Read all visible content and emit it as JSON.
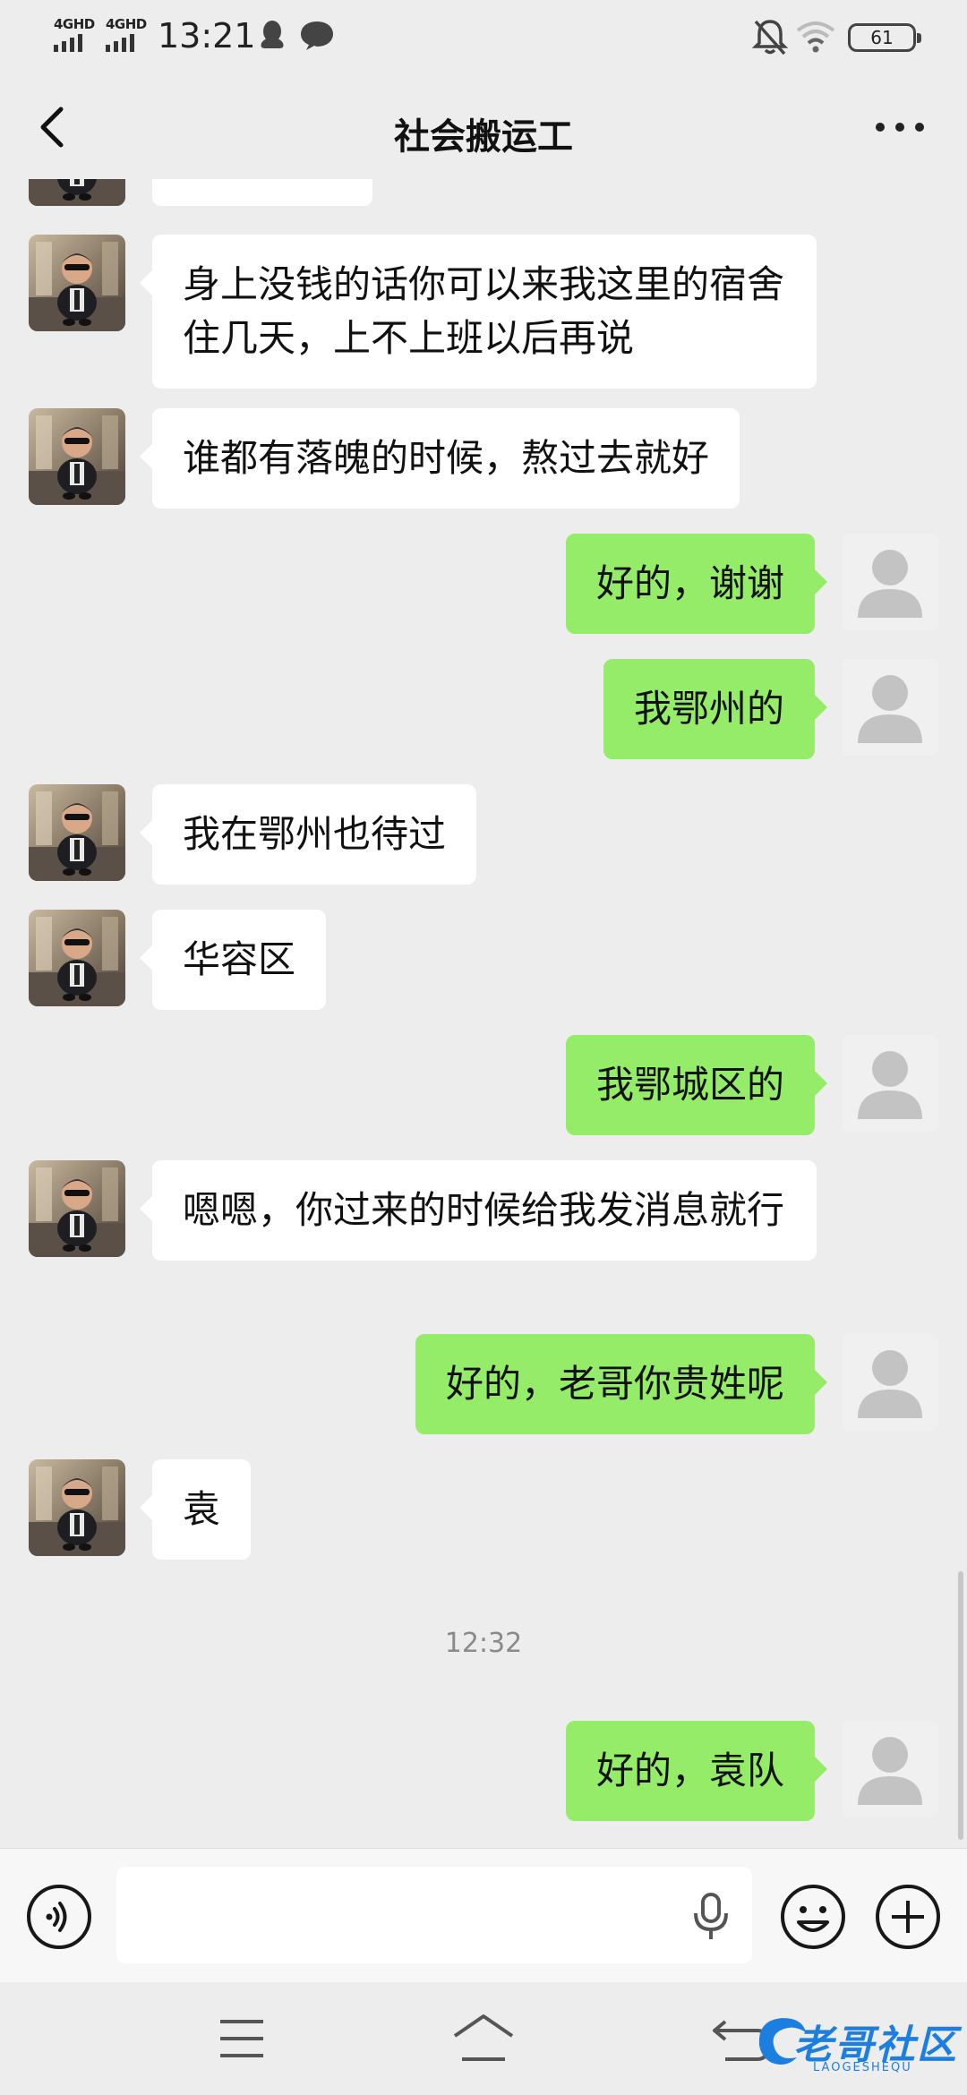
{
  "status_bar": {
    "network_1": "4GHD",
    "network_2": "4GHD",
    "time": "13:21",
    "battery": "61",
    "icons": [
      "qq-icon",
      "message-icon",
      "mute-icon",
      "wifi-icon",
      "battery-icon"
    ]
  },
  "header": {
    "title": "社会搬运工",
    "back_icon": "chevron-left-icon",
    "more_icon": "more-dots-icon"
  },
  "messages": [
    {
      "from": "other",
      "text": "身上没钱的话你可以来我这里的宿舍住几天，上不上班以后再说"
    },
    {
      "from": "other",
      "text": "谁都有落魄的时候，熬过去就好"
    },
    {
      "from": "me",
      "text": "好的，谢谢"
    },
    {
      "from": "me",
      "text": "我鄂州的"
    },
    {
      "from": "other",
      "text": "我在鄂州也待过"
    },
    {
      "from": "other",
      "text": "华容区"
    },
    {
      "from": "me",
      "text": "我鄂城区的"
    },
    {
      "from": "other",
      "text": "嗯嗯，你过来的时候给我发消息就行"
    },
    {
      "from": "me",
      "text": "好的，老哥你贵姓呢"
    },
    {
      "from": "other",
      "text": "袁"
    },
    {
      "from": "me",
      "text": "好的，袁队"
    }
  ],
  "timestamp": "12:32",
  "input_bar": {
    "value": "",
    "icons": [
      "voice-icon",
      "mic-icon",
      "emoji-icon",
      "plus-icon"
    ]
  },
  "nav_bar": {
    "icons": [
      "menu-icon",
      "home-icon",
      "back-icon"
    ]
  },
  "watermark": {
    "text": "老哥社区",
    "sub": "LAOGESHEQU"
  },
  "colors": {
    "background": "#ededed",
    "bubble_in": "#ffffff",
    "bubble_out": "#95ec69",
    "input_bar": "#f7f7f7",
    "watermark": "#1c7fe0"
  }
}
